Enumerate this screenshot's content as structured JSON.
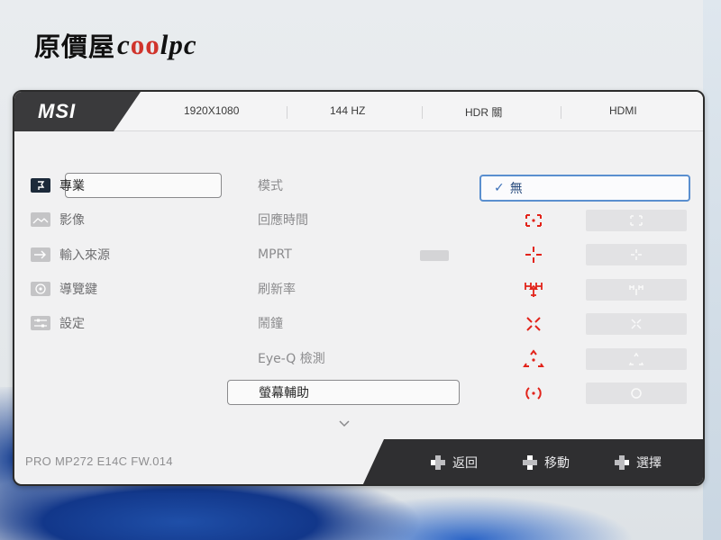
{
  "logo": {
    "chinese": "原價屋",
    "brand_c": "c",
    "brand_oo": "oo",
    "brand_rest": "lpc"
  },
  "osd": {
    "brand": "MSI",
    "status": {
      "resolution": "1920X1080",
      "refresh": "144 HZ",
      "hdr": "HDR 關",
      "input": "HDMI"
    },
    "nav": [
      {
        "label": "專業",
        "icon": "professional-icon",
        "active": true
      },
      {
        "label": "影像",
        "icon": "image-icon",
        "active": false
      },
      {
        "label": "輸入來源",
        "icon": "input-source-icon",
        "active": false
      },
      {
        "label": "導覽鍵",
        "icon": "navi-key-icon",
        "active": false
      },
      {
        "label": "設定",
        "icon": "settings-icon",
        "active": false
      }
    ],
    "submenu": [
      {
        "label": "模式"
      },
      {
        "label": "回應時間"
      },
      {
        "label": "MPRT"
      },
      {
        "label": "刷新率"
      },
      {
        "label": "鬧鐘"
      },
      {
        "label": "Eye-Q 檢測"
      },
      {
        "label": "螢幕輔助",
        "active": true
      }
    ],
    "options": {
      "selected_label": "無",
      "crosshair_icons": [
        "crosshair-center-dot-icon",
        "crosshair-plus-icon",
        "crosshair-cross-arrow-icon",
        "crosshair-x-icon",
        "crosshair-triangle-icon",
        "crosshair-circle-icon"
      ],
      "accent_color": "#e2231a",
      "selection_color": "#5a8fcf"
    },
    "footer": {
      "model": "PRO MP272 E14C   FW.014",
      "back": "返回",
      "move": "移動",
      "select": "選擇"
    }
  }
}
